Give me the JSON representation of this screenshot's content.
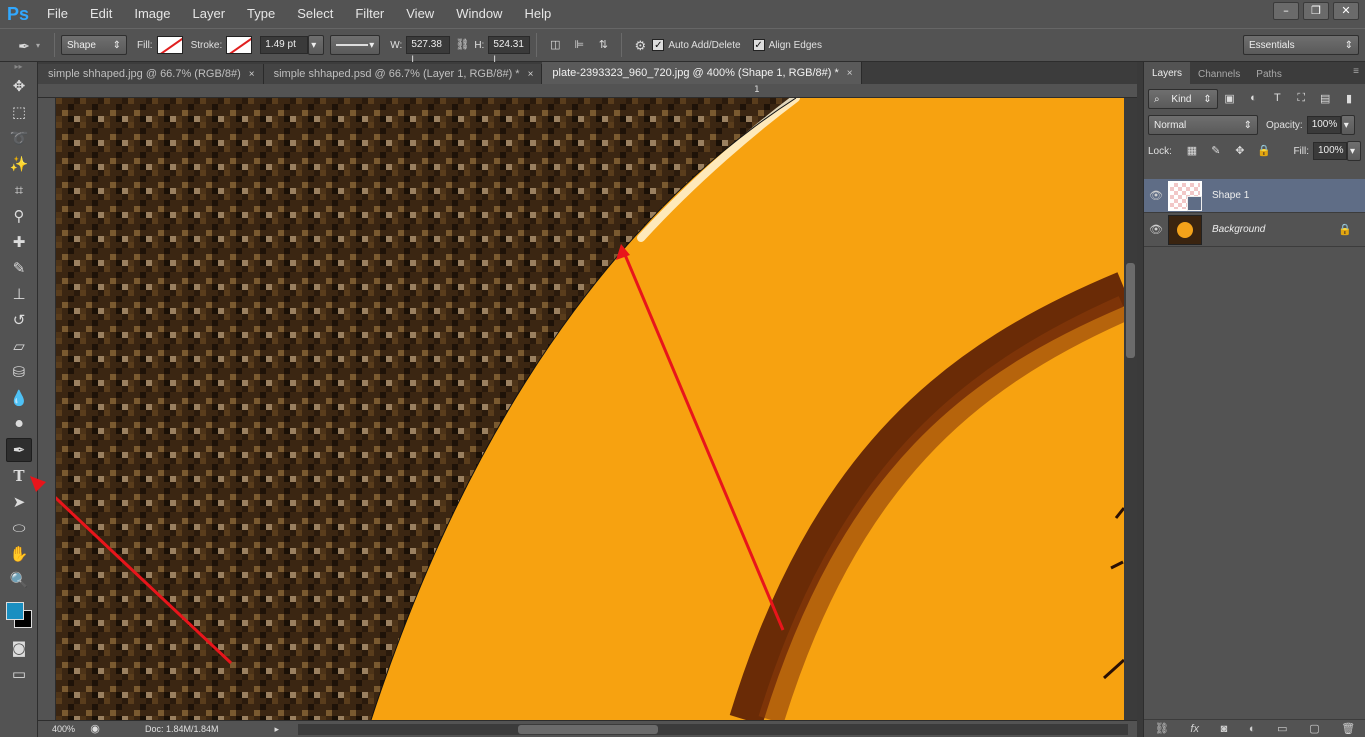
{
  "menubar": {
    "logo": "Ps",
    "items": [
      "File",
      "Edit",
      "Image",
      "Layer",
      "Type",
      "Select",
      "Filter",
      "View",
      "Window",
      "Help"
    ],
    "window_controls": [
      "–",
      "❐",
      "✕"
    ]
  },
  "options": {
    "mode": "Shape",
    "fill_label": "Fill:",
    "stroke_label": "Stroke:",
    "stroke_width": "1.49 pt",
    "w_label": "W:",
    "w_value": "527.38 |",
    "h_label": "H:",
    "h_value": "524.31 |",
    "auto_add_delete": "Auto Add/Delete",
    "align_edges": "Align Edges",
    "workspace": "Essentials"
  },
  "tabs": [
    {
      "label": "simple shhaped.jpg @ 66.7% (RGB/8#)",
      "close": "×"
    },
    {
      "label": "simple shhaped.psd @ 66.7% (Layer 1, RGB/8#) *",
      "close": "×"
    },
    {
      "label": "plate-2393323_960_720.jpg @ 400% (Shape 1, RGB/8#) *",
      "close": "×"
    }
  ],
  "ruler": {
    "top_number": "1"
  },
  "status": {
    "zoom": "400%",
    "doc": "Doc: 1.84M/1.84M"
  },
  "colors": {
    "foreground": "#1a8fc1",
    "background": "#000000",
    "accent_arrow": "#e8151b",
    "plate": "#f7a210"
  },
  "panel": {
    "tabs": [
      "Layers",
      "Channels",
      "Paths"
    ],
    "filter_kind": "Kind",
    "blend_mode": "Normal",
    "opacity_label": "Opacity:",
    "opacity_value": "100%",
    "lock_label": "Lock:",
    "fill_label": "Fill:",
    "fill_value": "100%",
    "layers": [
      {
        "name": "Shape 1"
      },
      {
        "name": "Background"
      }
    ]
  }
}
